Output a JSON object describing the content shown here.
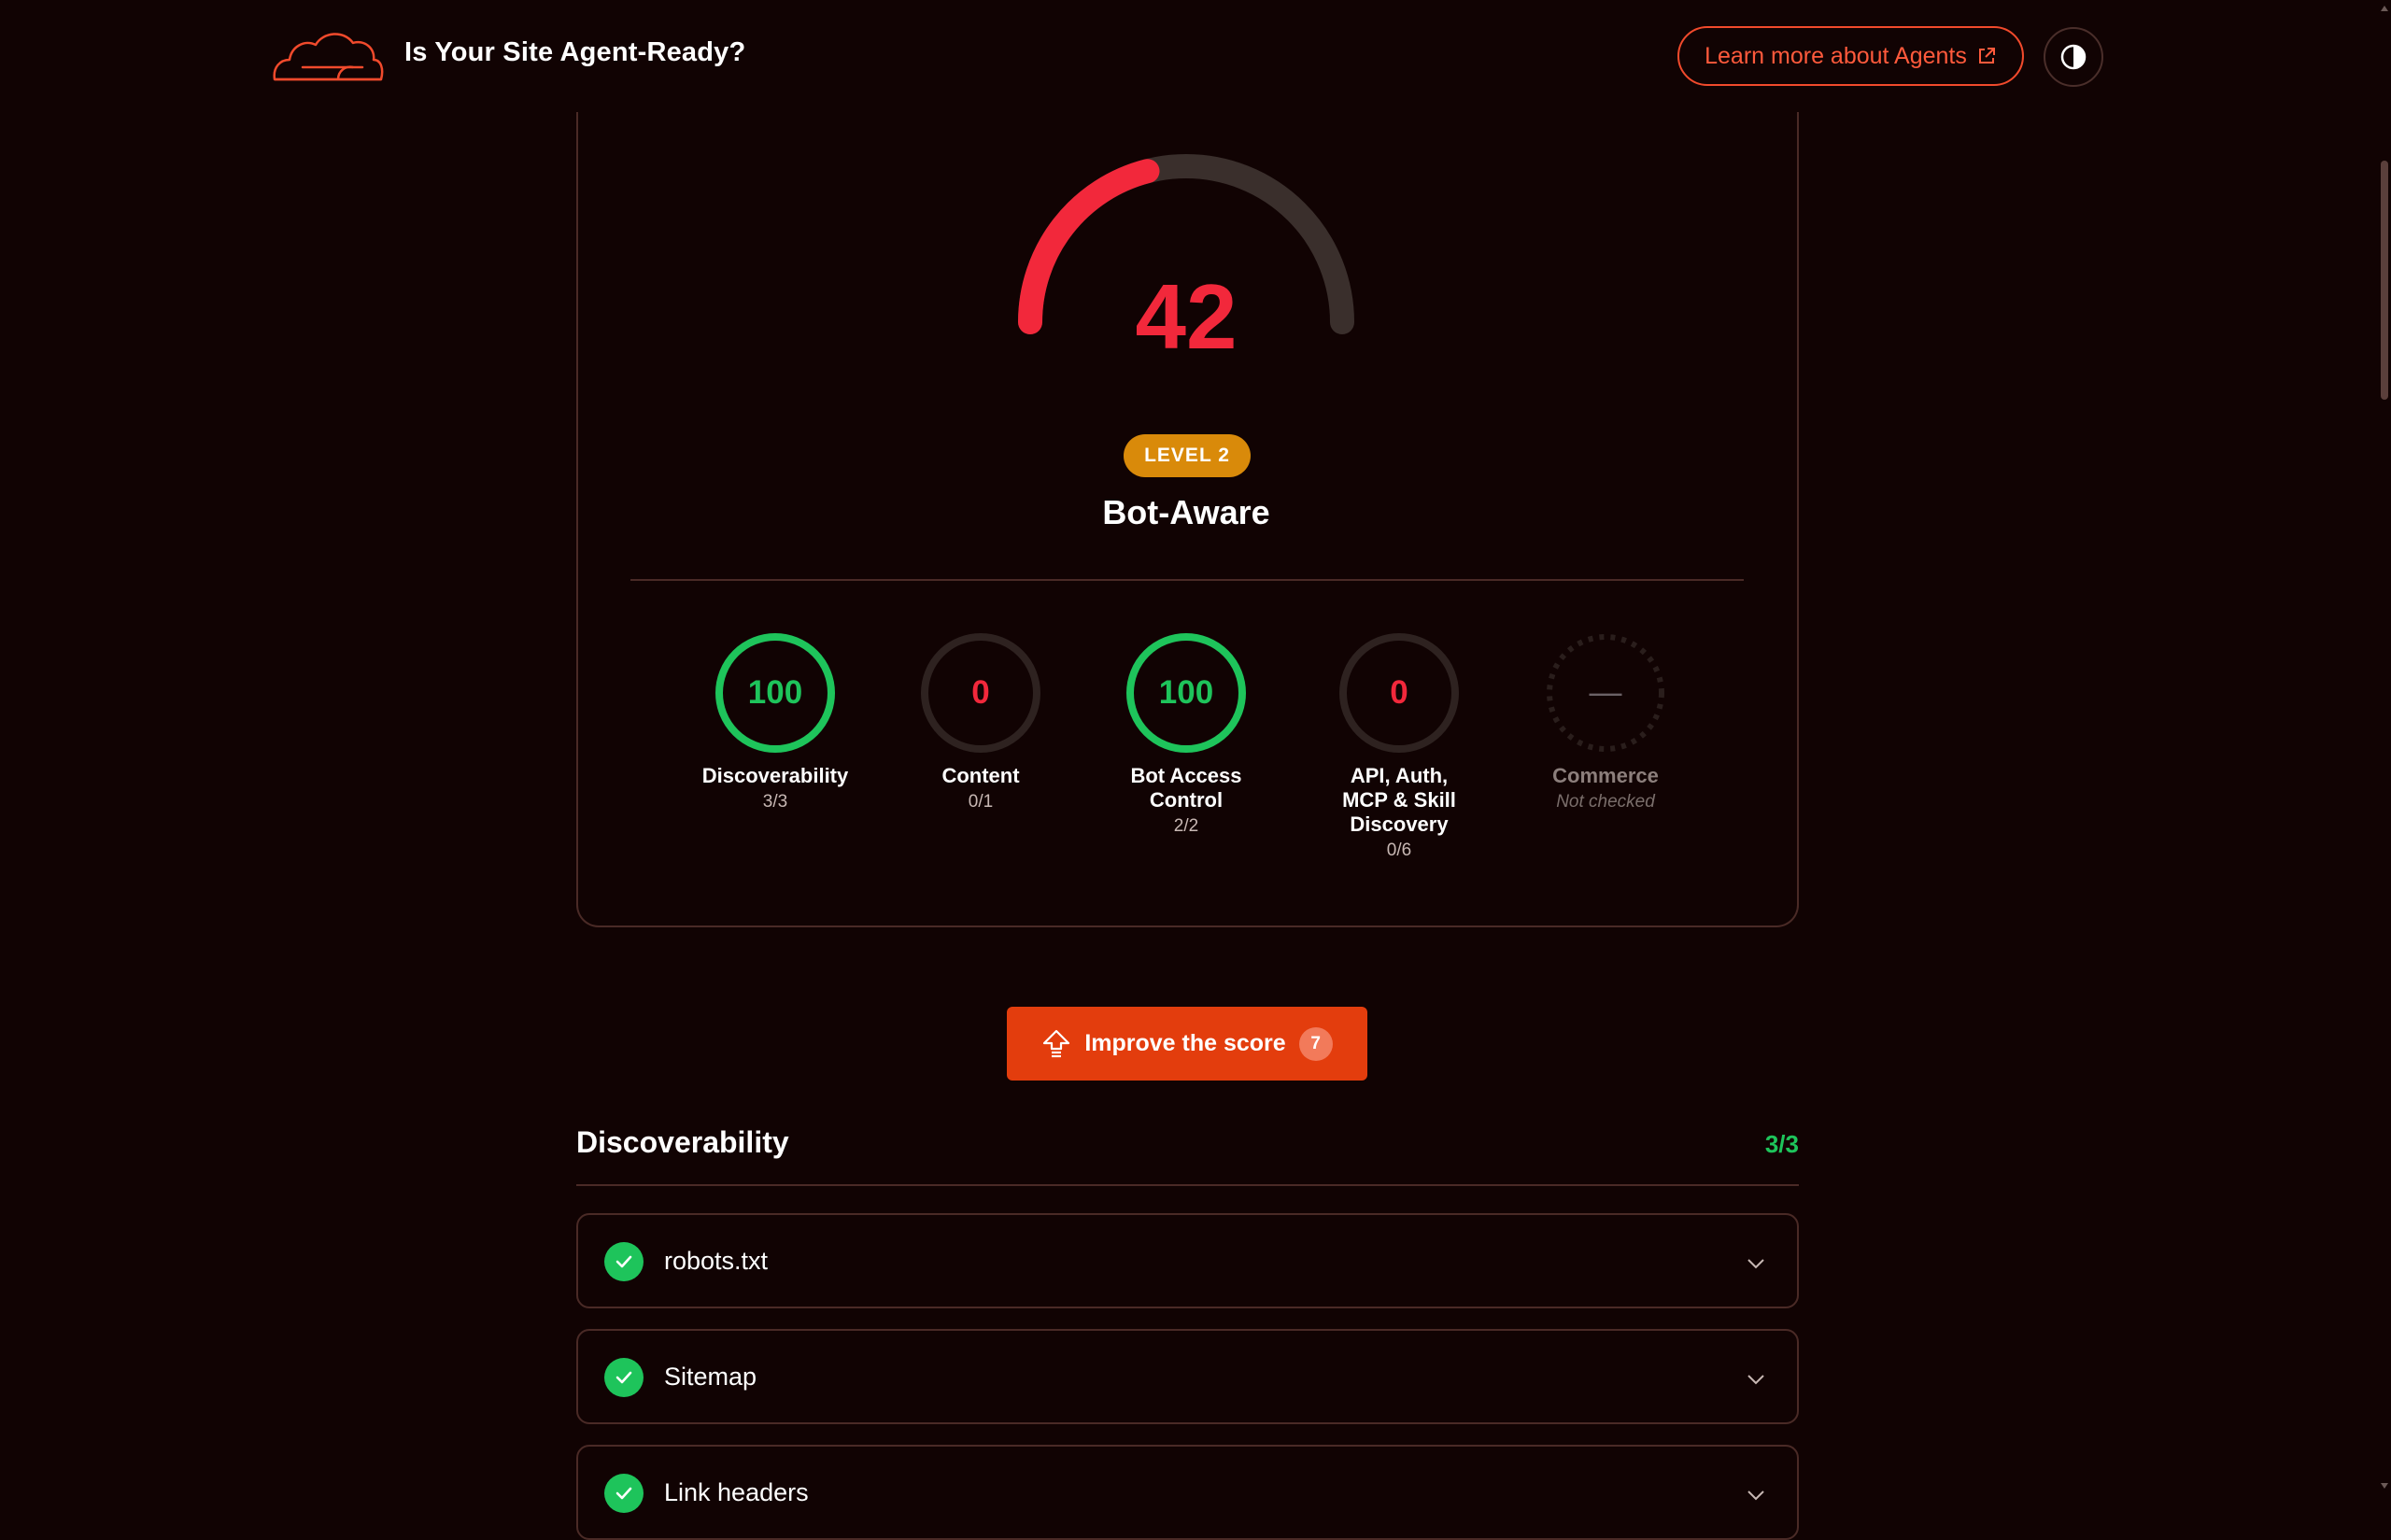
{
  "header": {
    "title": "Is Your Site Agent-Ready?",
    "learn_more_label": "Learn more about Agents",
    "brand_color": "#f14a2c"
  },
  "score": {
    "value": "42",
    "fraction": 0.42,
    "level_badge": "LEVEL 2",
    "level_name": "Bot-Aware",
    "color": "#f2283b"
  },
  "categories": [
    {
      "value": "100",
      "label": "Discoverability",
      "count": "3/3",
      "status": "pass"
    },
    {
      "value": "0",
      "label": "Content",
      "count": "0/1",
      "status": "fail"
    },
    {
      "value": "100",
      "label": "Bot Access Control",
      "count": "2/2",
      "status": "pass"
    },
    {
      "value": "0",
      "label": "API, Auth, MCP & Skill Discovery",
      "count": "0/6",
      "status": "fail"
    },
    {
      "value": "—",
      "label": "Commerce",
      "count": "Not checked",
      "status": "unchecked"
    }
  ],
  "improve": {
    "label": "Improve the score",
    "count": "7"
  },
  "discoverability": {
    "title": "Discoverability",
    "score": "3/3",
    "items": [
      {
        "label": "robots.txt"
      },
      {
        "label": "Sitemap"
      },
      {
        "label": "Link headers"
      }
    ]
  }
}
